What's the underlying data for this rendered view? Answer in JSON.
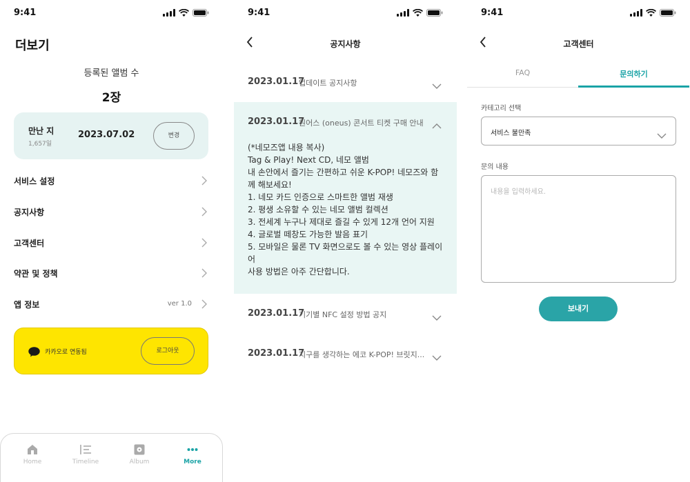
{
  "status_bar": {
    "time": "9:41"
  },
  "more_screen": {
    "title": "더보기",
    "album_count_label": "등록된 앨범 수",
    "album_count": "2장",
    "meet_label": "만난 지",
    "meet_days": "1,657일",
    "meet_date": "2023.07.02",
    "change_label": "변경",
    "menu": [
      {
        "label": "서비스 설정"
      },
      {
        "label": "공지사항"
      },
      {
        "label": "고객센터"
      },
      {
        "label": "약관 및 정책"
      },
      {
        "label": "앱 정보",
        "value": "ver 1.0"
      }
    ],
    "kakao_status": "카카오로 연동됨",
    "logout_label": "로그아웃",
    "tabbar": [
      {
        "label": "Home",
        "icon": "home-icon"
      },
      {
        "label": "Timeline",
        "icon": "timeline-icon"
      },
      {
        "label": "Album",
        "icon": "album-icon"
      },
      {
        "label": "More",
        "icon": "more-icon",
        "active": true
      }
    ],
    "kakao_color": "#fee500",
    "accent_color": "#1aa3a6"
  },
  "notice_screen": {
    "title": "공지사항",
    "items": [
      {
        "date": "2023.01.17",
        "title": "업데이트 공지사항",
        "expanded": false
      },
      {
        "date": "2023.01.17",
        "title": "원어스 (oneus) 콘서트 티켓 구매 안내",
        "expanded": true,
        "body": [
          "(*네모즈앱 내용 복사)",
          "Tag & Play! Next CD, 네모 앨범",
          "내 손안에서 즐기는 간편하고 쉬운 K-POP! 네모즈와 함",
          "께 해보세요!",
          "1. 네모 카드 인증으로 스마트한 앨범 재생",
          "2. 평생 소유할 수 있는 네모 앨범 컬렉션",
          "3. 전세계 누구나 제대로 즐길 수 있게 12개 언어 지원",
          "4. 글로벌 떼창도 가능한 발음 표기",
          "5. 모바일은 물론 TV 화면으로도 볼 수 있는 영상 플레이",
          "어",
          "사용 방법은 아주 간단합니다."
        ]
      },
      {
        "date": "2023.01.17",
        "title": "기기별 NFC 설정 방법 공지",
        "expanded": false
      },
      {
        "date": "2023.01.17",
        "title": "지구를 생각하는 에코 K-POP! 브릿지...",
        "expanded": false
      }
    ]
  },
  "support_screen": {
    "title": "고객센터",
    "tabs": [
      {
        "label": "FAQ",
        "active": false
      },
      {
        "label": "문의하기",
        "active": true
      }
    ],
    "category_label": "카테고리 선택",
    "category_value": "서비스 불만족",
    "content_label": "문의 내용",
    "content_placeholder": "내용을 입력하세요.",
    "send_label": "보내기"
  }
}
